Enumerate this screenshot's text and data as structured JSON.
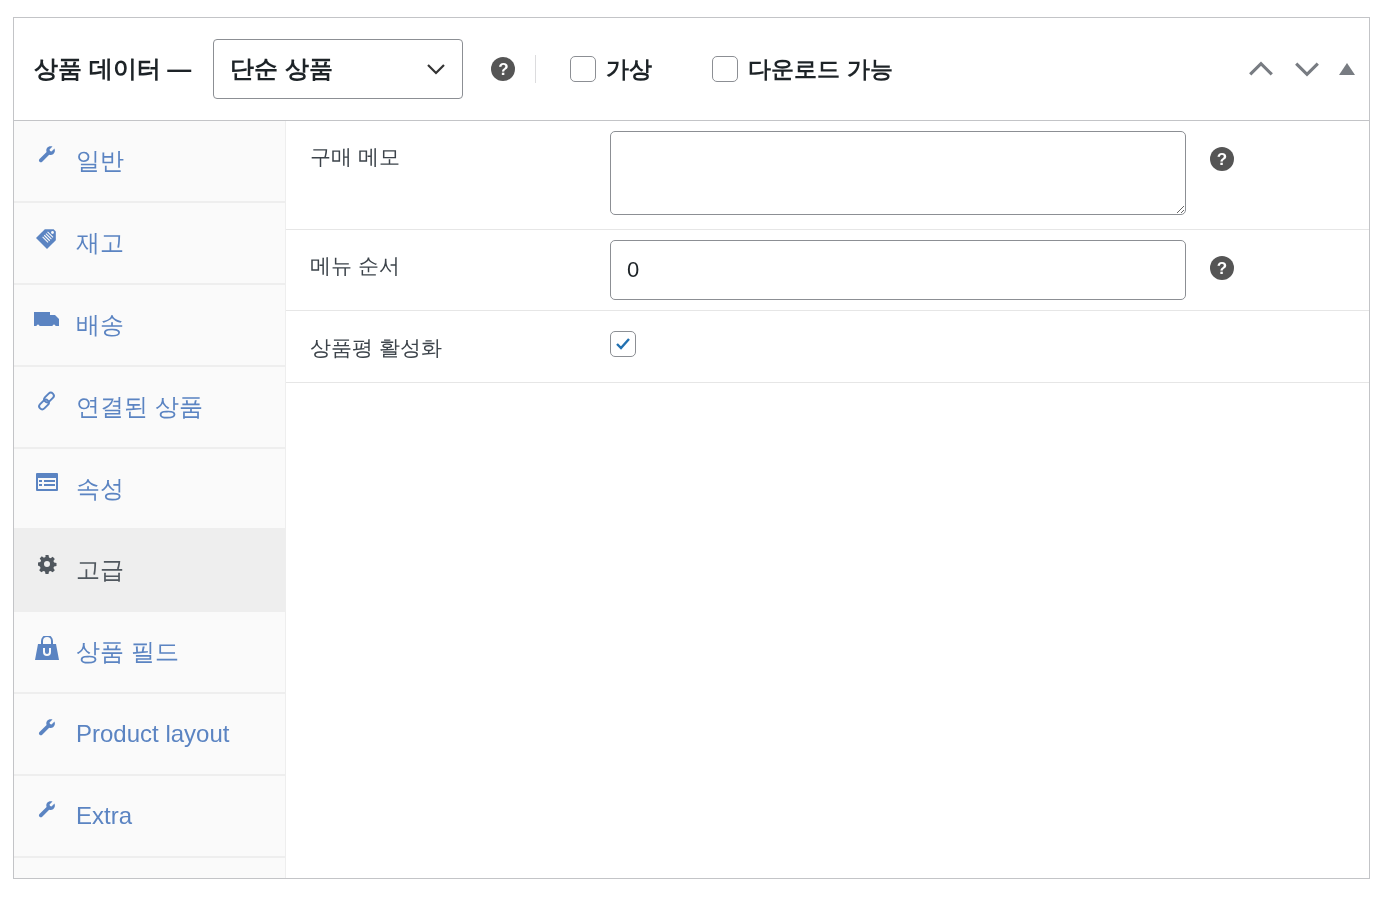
{
  "panel": {
    "title": "상품 데이터 —",
    "product_type": "단순 상품",
    "help": "?",
    "options": [
      {
        "label": "가상",
        "checked": false
      },
      {
        "label": "다운로드 가능",
        "checked": false
      }
    ]
  },
  "tabs": [
    {
      "label": "일반",
      "kind": "wrench",
      "selected": false
    },
    {
      "label": "재고",
      "kind": "tag",
      "selected": false
    },
    {
      "label": "배송",
      "kind": "truck",
      "selected": false
    },
    {
      "label": "연결된 상품",
      "kind": "link",
      "selected": false
    },
    {
      "label": "속성",
      "kind": "table",
      "selected": false
    },
    {
      "label": "고급",
      "kind": "gear",
      "selected": true
    },
    {
      "label": "상품 필드",
      "kind": "bag",
      "selected": false
    },
    {
      "label": "Product layout",
      "kind": "wrench",
      "selected": false
    },
    {
      "label": "Extra",
      "kind": "wrench",
      "selected": false
    }
  ],
  "fields": [
    {
      "kind": "textarea",
      "label": "구매 메모",
      "help": "?"
    },
    {
      "kind": "number",
      "label": "메뉴 순서",
      "value": "0",
      "help": "?"
    },
    {
      "kind": "checkbox",
      "label": "상품평 활성화",
      "checked": true
    }
  ]
}
